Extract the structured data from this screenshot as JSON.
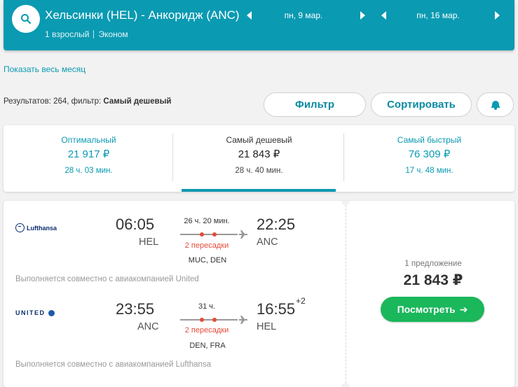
{
  "header": {
    "route": "Хельсинки (HEL) - Анкоридж (ANC)",
    "passengers": "1 взрослый",
    "cabin": "Эконом",
    "depart_date": "пн, 9 мар.",
    "return_date": "пн, 16 мар."
  },
  "month_link": "Показать весь месяц",
  "results": {
    "prefix": "Результатов: 264, фильтр:",
    "filter_value": "Самый дешевый"
  },
  "actions": {
    "filter": "Фильтр",
    "sort": "Сортировать"
  },
  "tabs": [
    {
      "title": "Оптимальный",
      "price": "21 917 ₽",
      "duration": "28 ч. 03 мин."
    },
    {
      "title": "Самый дешевый",
      "price": "21 843 ₽",
      "duration": "28 ч. 40 мин."
    },
    {
      "title": "Самый быстрый",
      "price": "76 309 ₽",
      "duration": "17 ч. 48 мин."
    }
  ],
  "flight": {
    "outbound": {
      "airline": "Lufthansa",
      "dep_time": "06:05",
      "dep_code": "HEL",
      "arr_time": "22:25",
      "arr_code": "ANC",
      "duration": "26 ч. 20 мин.",
      "stops": "2 пересадки",
      "via": "MUC, DEN",
      "codeshare": "Выполняется совместно с авиакомпанией United"
    },
    "inbound": {
      "airline": "UNITED",
      "dep_time": "23:55",
      "dep_code": "ANC",
      "arr_time": "16:55",
      "arr_day_offset": "+2",
      "arr_code": "HEL",
      "duration": "31 ч.",
      "stops": "2 пересадки",
      "via": "DEN, FRA",
      "codeshare": "Выполняется совместно с авиакомпанией Lufthansa"
    },
    "offers": "1 предложение",
    "price": "21 843 ₽",
    "view_label": "Посмотреть"
  },
  "colors": {
    "brand": "#0a9ab2",
    "stops": "#e64a3b",
    "cta": "#1bb75b"
  }
}
